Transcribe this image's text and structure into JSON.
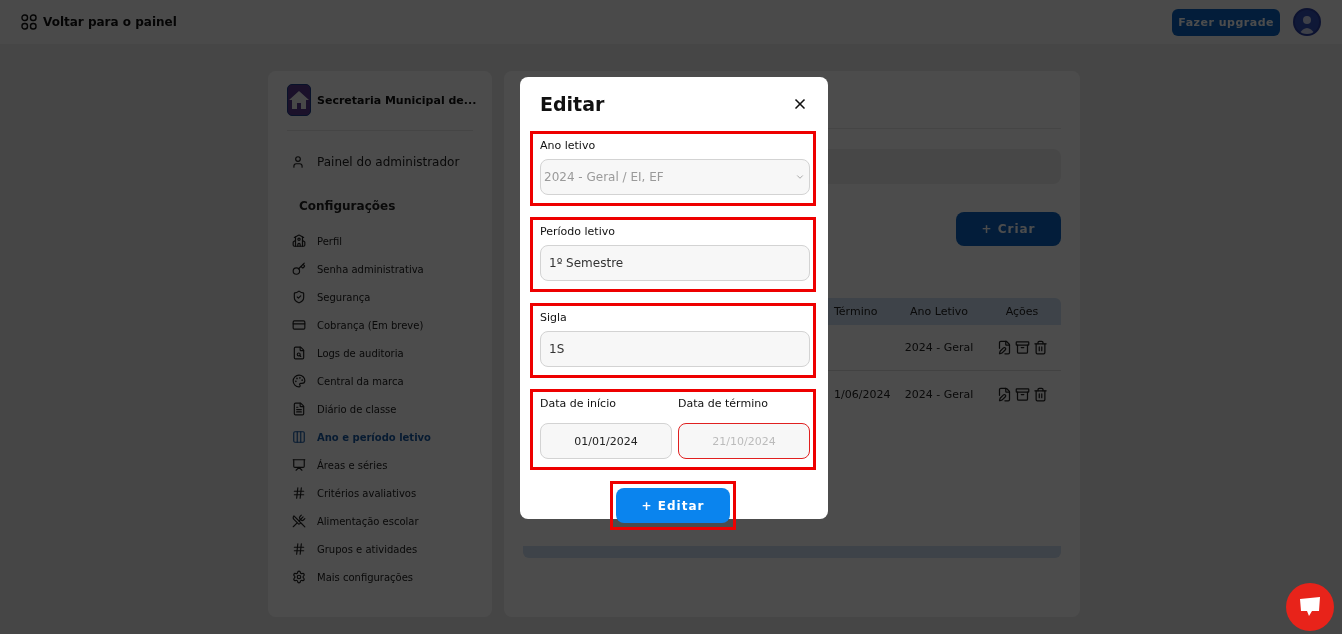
{
  "topbar": {
    "back_label": "Voltar para o painel",
    "upgrade_button": "Fazer upgrade"
  },
  "sidebar": {
    "org_name": "Secretaria Municipal de...",
    "admin_link": "Painel do administrador",
    "section_title": "Configurações",
    "items": [
      {
        "label": "Perfil",
        "selected": false
      },
      {
        "label": "Senha administrativa",
        "selected": false
      },
      {
        "label": "Segurança",
        "selected": false
      },
      {
        "label": "Cobrança (Em breve)",
        "selected": false
      },
      {
        "label": "Logs de auditoria",
        "selected": false
      },
      {
        "label": "Central da marca",
        "selected": false
      },
      {
        "label": "Diário de classe",
        "selected": false
      },
      {
        "label": "Ano e período letivo",
        "selected": true
      },
      {
        "label": "Áreas e séries",
        "selected": false
      },
      {
        "label": "Critérios avaliativos",
        "selected": false
      },
      {
        "label": "Alimentação escolar",
        "selected": false
      },
      {
        "label": "Grupos e atividades",
        "selected": false
      },
      {
        "label": "Mais configurações",
        "selected": false
      }
    ]
  },
  "content": {
    "create_button": "+ Criar",
    "table": {
      "columns": [
        "Término",
        "Ano Letivo",
        "Ações"
      ],
      "rows": [
        {
          "cells": [
            "",
            "2024 - Geral"
          ]
        },
        {
          "cells": [
            "1/06/2024",
            "2024 - Geral"
          ]
        }
      ]
    }
  },
  "modal": {
    "title": "Editar",
    "fields": [
      {
        "kind": "select",
        "label": "Ano letivo",
        "value": "2024 - Geral / EI, EF",
        "disabled": true,
        "highlighted": true
      },
      {
        "kind": "text",
        "label": "Período letivo",
        "value": "1º Semestre",
        "highlighted": true
      },
      {
        "kind": "text",
        "label": "Sigla",
        "value": "1S",
        "highlighted": true
      }
    ],
    "dates": {
      "highlighted": true,
      "start_label": "Data de início",
      "start_value": "01/01/2024",
      "end_label": "Data de término",
      "end_value": "21/10/2024",
      "end_invalid": true
    },
    "submit": {
      "label": "+ Editar",
      "highlighted": true
    }
  }
}
